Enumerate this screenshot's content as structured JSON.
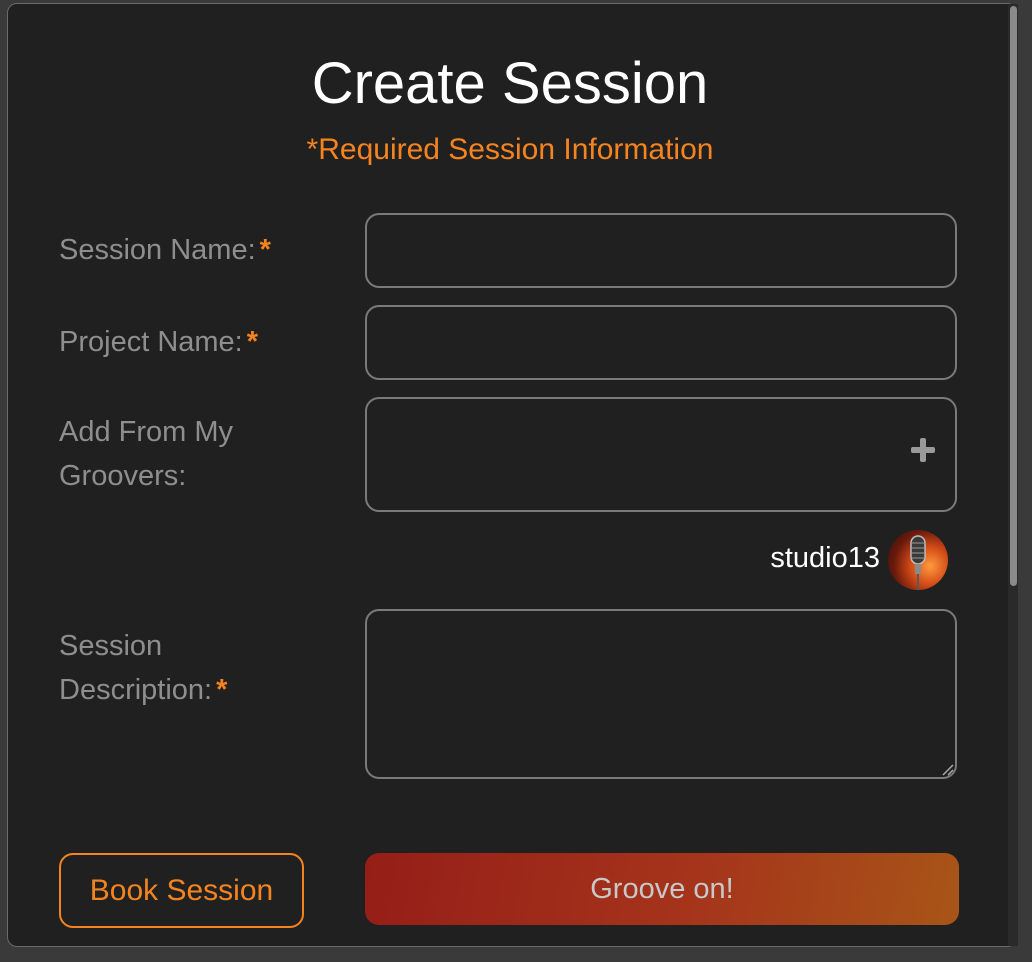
{
  "form": {
    "title": "Create Session",
    "required_note": "*Required Session Information",
    "session_name": {
      "label": "Session Name:",
      "required_mark": "*",
      "value": ""
    },
    "project_name": {
      "label": "Project Name:",
      "required_mark": "*",
      "value": ""
    },
    "groovers": {
      "label_line1": "Add From My",
      "label_line2": "Groovers:",
      "value": "",
      "add_icon": "plus-icon"
    },
    "selected_member": {
      "name": "studio13",
      "avatar_icon": "microphone-avatar"
    },
    "description": {
      "label_line1": "Session",
      "label_line2": "Description:",
      "required_mark": "*",
      "value": ""
    }
  },
  "actions": {
    "book_label": "Book Session",
    "submit_label": "Groove on!"
  },
  "colors": {
    "accent": "#f5841f",
    "background": "#202020",
    "label": "#8e8e8e",
    "submit_gradient_start": "#951e18",
    "submit_gradient_end": "#a85518"
  }
}
